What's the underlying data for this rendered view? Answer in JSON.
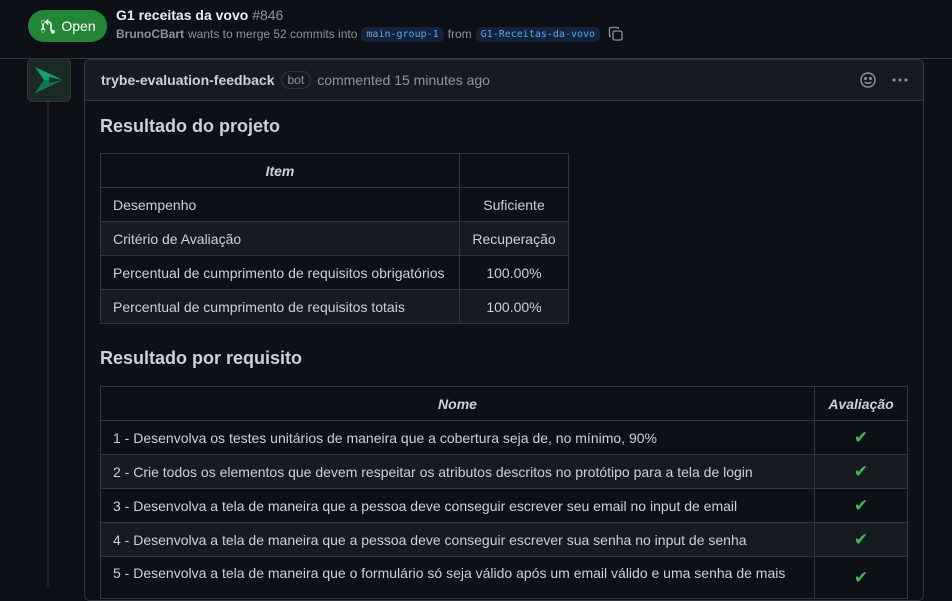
{
  "pr": {
    "state_label": "Open",
    "title": "G1 receitas da vovo",
    "number": "#846",
    "author": "BrunoCBart",
    "merge_text": "wants to merge 52 commits into",
    "base_branch": "main-group-1",
    "from_text": "from",
    "head_branch": "G1-Receitas-da-vovo"
  },
  "comment": {
    "author": "trybe-evaluation-feedback",
    "badge": "bot",
    "time_text": "commented 15 minutes ago"
  },
  "result": {
    "heading": "Resultado do projeto",
    "col_item": "Item",
    "col_value": "",
    "rows": [
      {
        "item": "Desempenho",
        "value": "Suficiente"
      },
      {
        "item": "Critério de Avaliação",
        "value": "Recuperação"
      },
      {
        "item": "Percentual de cumprimento de requisitos obrigatórios",
        "value": "100.00%"
      },
      {
        "item": "Percentual de cumprimento de requisitos totais",
        "value": "100.00%"
      }
    ]
  },
  "requirements": {
    "heading": "Resultado por requisito",
    "col_name": "Nome",
    "col_eval": "Avaliação",
    "rows": [
      {
        "name": "1 - Desenvolva os testes unitários de maneira que a cobertura seja de, no mínimo, 90%",
        "eval": "✔"
      },
      {
        "name": "2 - Crie todos os elementos que devem respeitar os atributos descritos no protótipo para a tela de login",
        "eval": "✔"
      },
      {
        "name": "3 - Desenvolva a tela de maneira que a pessoa deve conseguir escrever seu email no input de email",
        "eval": "✔"
      },
      {
        "name": "4 - Desenvolva a tela de maneira que a pessoa deve conseguir escrever sua senha no input de senha",
        "eval": "✔"
      },
      {
        "name": "5 - Desenvolva a tela de maneira que o formulário só seja válido após um email válido e uma senha de mais",
        "eval": "✔"
      }
    ]
  },
  "colors": {
    "open": "#238636",
    "check": "#3fb950",
    "branch": "#58a6ff"
  }
}
